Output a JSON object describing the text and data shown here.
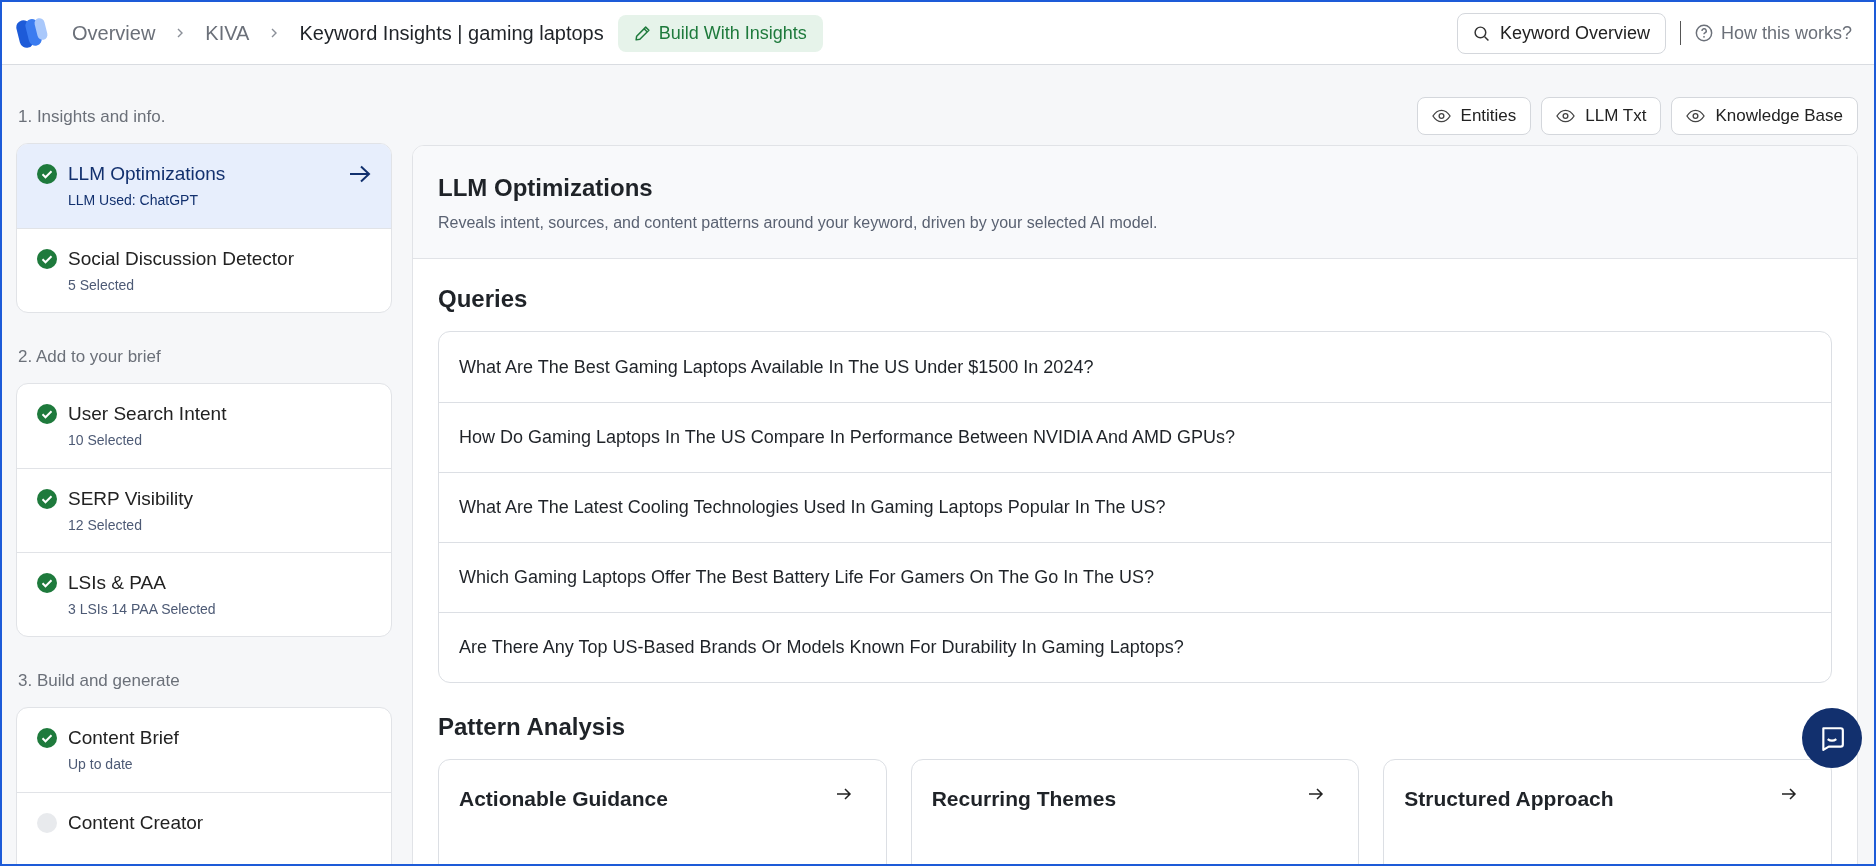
{
  "header": {
    "breadcrumbs": [
      {
        "label": "Overview"
      },
      {
        "label": "KIVA"
      }
    ],
    "current": "Keyword Insights | gaming laptops",
    "build_button": "Build With Insights",
    "overview_button": "Keyword Overview",
    "help_link": "How this works?"
  },
  "toolbar_buttons": [
    "Entities",
    "LLM Txt",
    "Knowledge Base"
  ],
  "sidebar": {
    "sections": [
      {
        "title": "1. Insights and info.",
        "items": [
          {
            "title": "LLM Optimizations",
            "subtitle": "LLM Used: ChatGPT",
            "done": true,
            "selected": true
          },
          {
            "title": "Social Discussion Detector",
            "subtitle": "5 Selected",
            "done": true,
            "selected": false
          }
        ]
      },
      {
        "title": "2. Add to your brief",
        "items": [
          {
            "title": "User Search Intent",
            "subtitle": "10 Selected",
            "done": true,
            "selected": false
          },
          {
            "title": "SERP Visibility",
            "subtitle": "12 Selected",
            "done": true,
            "selected": false
          },
          {
            "title": "LSIs & PAA",
            "subtitle": "3 LSIs 14 PAA Selected",
            "done": true,
            "selected": false
          }
        ]
      },
      {
        "title": "3. Build and generate",
        "items": [
          {
            "title": "Content Brief",
            "subtitle": "Up to date",
            "done": true,
            "selected": false
          },
          {
            "title": "Content Creator",
            "done": false,
            "selected": false
          }
        ]
      }
    ]
  },
  "main": {
    "title": "LLM Optimizations",
    "description": "Reveals intent, sources, and content patterns around your keyword, driven by your selected AI model.",
    "queries_heading": "Queries",
    "queries": [
      "What Are The Best Gaming Laptops Available In The US Under $1500 In 2024?",
      "How Do Gaming Laptops In The US Compare In Performance Between NVIDIA And AMD GPUs?",
      "What Are The Latest Cooling Technologies Used In Gaming Laptops Popular In The US?",
      "Which Gaming Laptops Offer The Best Battery Life For Gamers On The Go In The US?",
      "Are There Any Top US-Based Brands Or Models Known For Durability In Gaming Laptops?"
    ],
    "pattern_heading": "Pattern Analysis",
    "pattern_cards": [
      "Actionable Guidance",
      "Recurring Themes",
      "Structured Approach"
    ]
  }
}
